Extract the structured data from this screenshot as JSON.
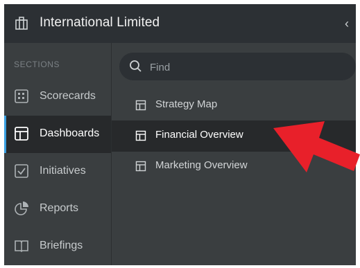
{
  "header": {
    "org_name": "International Limited",
    "collapse_icon": "chevron-left-icon"
  },
  "sidebar": {
    "sections_label": "SECTIONS",
    "active_item": "Dashboards",
    "items": [
      {
        "label": "Scorecards",
        "icon": "scorecard-icon"
      },
      {
        "label": "Dashboards",
        "icon": "dashboard-icon"
      },
      {
        "label": "Initiatives",
        "icon": "checkbox-icon"
      },
      {
        "label": "Reports",
        "icon": "pie-chart-icon"
      },
      {
        "label": "Briefings",
        "icon": "book-icon"
      }
    ]
  },
  "main": {
    "search_placeholder": "Find",
    "selected_item": "Financial Overview",
    "items": [
      {
        "label": "Strategy Map",
        "icon": "dashboard-icon"
      },
      {
        "label": "Financial Overview",
        "icon": "dashboard-icon"
      },
      {
        "label": "Marketing Overview",
        "icon": "dashboard-icon"
      }
    ]
  },
  "colors": {
    "accent": "#3aa0e0",
    "arrow": "#e8202a",
    "sidebar_bg": "#3a3e40",
    "header_bg": "#2c3034",
    "active_bg": "#27292b"
  }
}
